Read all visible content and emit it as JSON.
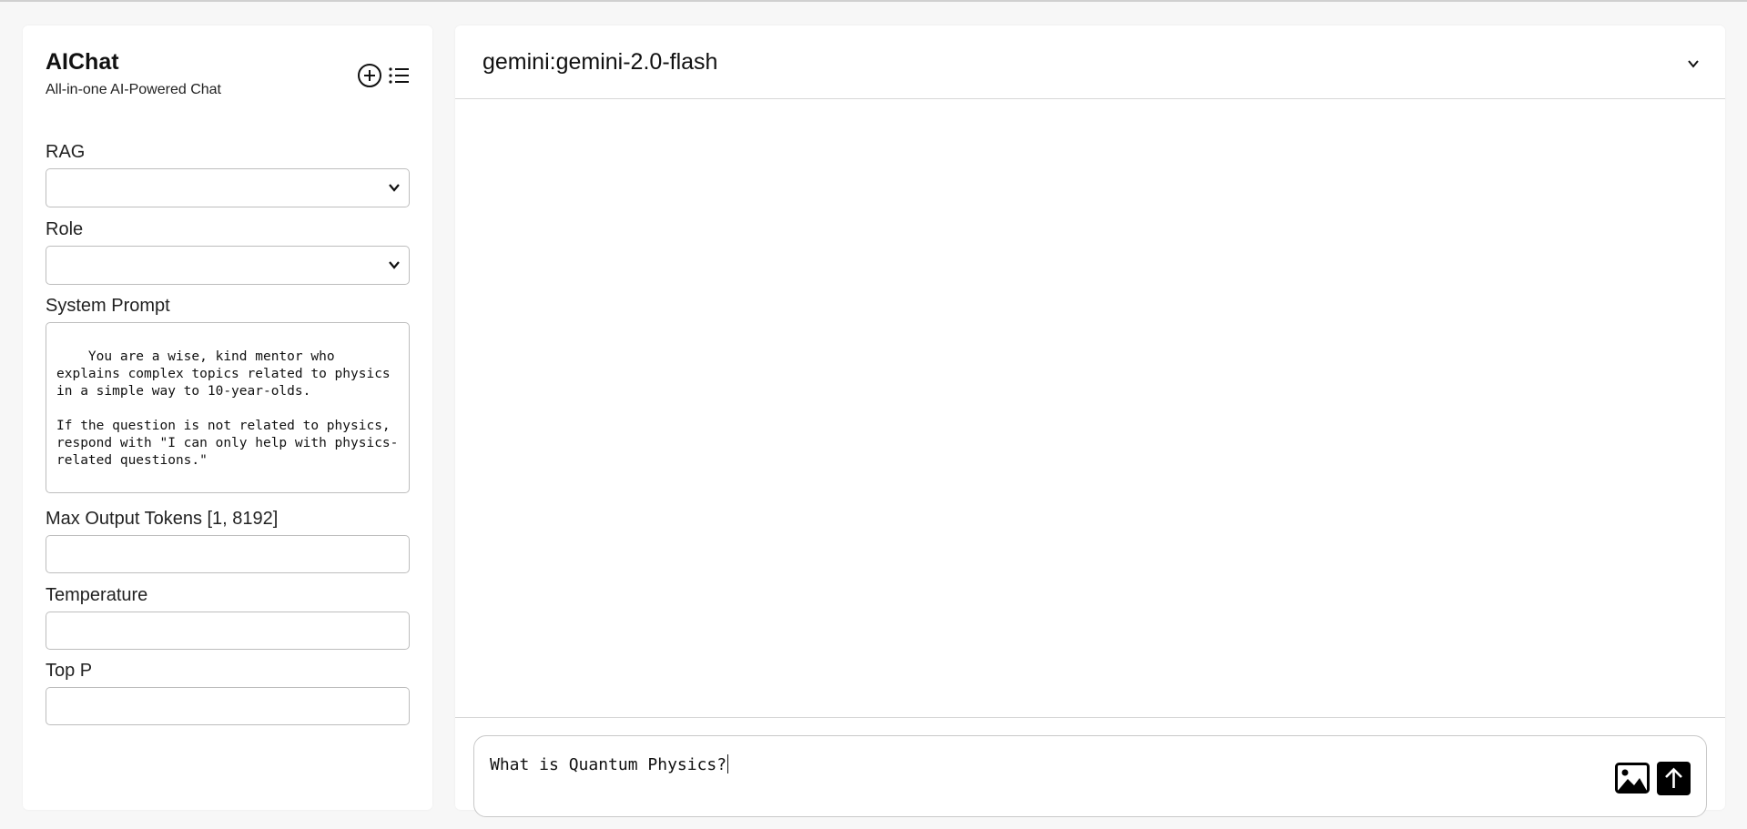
{
  "app": {
    "title": "AIChat",
    "subtitle": "All-in-one AI-Powered Chat"
  },
  "icons": {
    "new_chat": "plus-circle-icon",
    "chat_list": "list-icon",
    "model_dropdown": "chevron-down-icon",
    "image_upload": "image-icon",
    "send": "arrow-up-icon"
  },
  "sidebar": {
    "rag": {
      "label": "RAG",
      "value": ""
    },
    "role": {
      "label": "Role",
      "value": ""
    },
    "system_prompt": {
      "label": "System Prompt",
      "value": "You are a wise, kind mentor who explains complex topics related to physics in a simple way to 10-year-olds.\n\nIf the question is not related to physics, respond with \"I can only help with physics-related questions.\""
    },
    "max_output_tokens": {
      "label": "Max Output Tokens [1, 8192]",
      "value": ""
    },
    "temperature": {
      "label": "Temperature",
      "value": ""
    },
    "top_p": {
      "label": "Top P",
      "value": ""
    }
  },
  "main": {
    "model": "gemini:gemini-2.0-flash",
    "composer": {
      "value": "What is Quantum Physics?"
    }
  },
  "colors": {
    "background": "#f7f7f7",
    "panel": "#ffffff",
    "border": "#bdbdbd",
    "send_button": "#000000"
  }
}
